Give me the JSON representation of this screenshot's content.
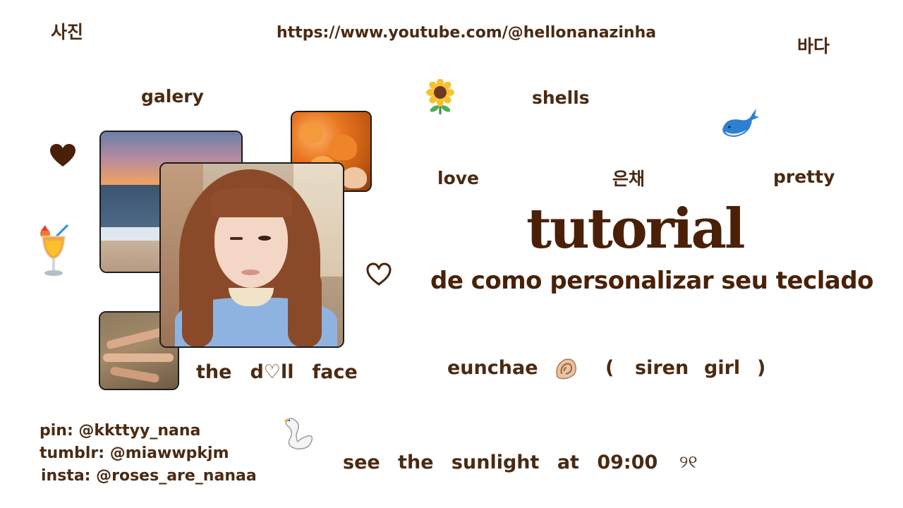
{
  "top": {
    "korean_photo": "사진",
    "url": "https://www.youtube.com/@hellonanazinha",
    "korean_sea": "바다"
  },
  "labels": {
    "galery": "galery",
    "shells": "shells",
    "love": "love",
    "name_korean": "은채",
    "pretty": "pretty"
  },
  "title": {
    "main": "tutorial",
    "subtitle": "de como personalizar seu teclado"
  },
  "caption_left": {
    "word1": "the",
    "word2": "d",
    "heart": "♡",
    "word3": "ll",
    "word4": "face"
  },
  "eunchae_line": {
    "name": "eunchae",
    "open_paren": "(",
    "siren": "siren",
    "girl": "girl",
    "close_paren": ")"
  },
  "socials": {
    "pin": "pin: @kkttyy_nana",
    "tumblr": "tumblr: @miawwpkjm",
    "insta": "insta: @roses_are_nanaa"
  },
  "sunlight_line": {
    "text": "see the sunlight at 09:00",
    "glyph": "୨୧"
  },
  "icons": [
    "heart-filled-icon",
    "cocktail-icon",
    "sunflower-icon",
    "whale-icon",
    "heart-outline-icon",
    "shell-icon",
    "swan-icon"
  ],
  "colors": {
    "text": "#4a2a12",
    "title": "#4a2108"
  }
}
